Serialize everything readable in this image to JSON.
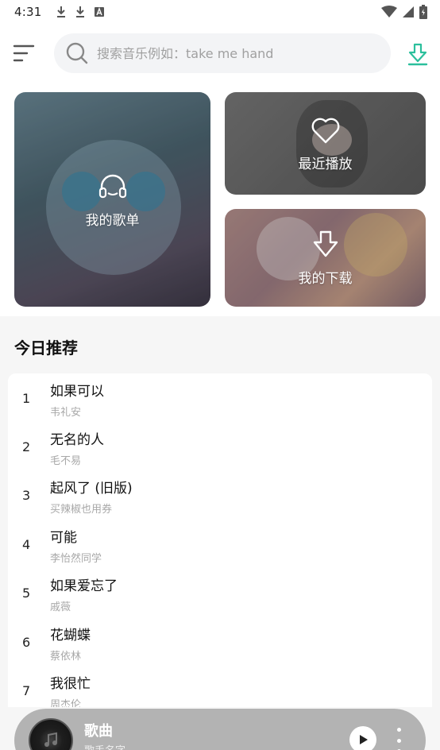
{
  "status_bar": {
    "time": "4:31"
  },
  "header": {
    "menu_icon": "menu-lines-icon",
    "search": {
      "placeholder": "搜索音乐例如：take me hand",
      "value": ""
    },
    "download_icon": "download-arrow-icon"
  },
  "cards": {
    "playlist": {
      "label": "我的歌单",
      "icon": "headphones-icon"
    },
    "recent": {
      "label": "最近播放",
      "icon": "heart-icon"
    },
    "download": {
      "label": "我的下载",
      "icon": "download-arrow-icon"
    }
  },
  "recommend": {
    "title": "今日推荐",
    "songs": [
      {
        "index": "1",
        "title": "如果可以",
        "artist": "韦礼安"
      },
      {
        "index": "2",
        "title": "无名的人",
        "artist": "毛不易"
      },
      {
        "index": "3",
        "title": "起风了 (旧版)",
        "artist": "买辣椒也用券"
      },
      {
        "index": "4",
        "title": "可能",
        "artist": "李怡然同学"
      },
      {
        "index": "5",
        "title": "如果爱忘了",
        "artist": "戚薇"
      },
      {
        "index": "6",
        "title": "花蝴蝶",
        "artist": "蔡依林"
      },
      {
        "index": "7",
        "title": "我很忙",
        "artist": "周杰伦"
      }
    ]
  },
  "player": {
    "title": "歌曲",
    "artist": "歌手名字",
    "colors": {
      "bar": "#b3b3b3",
      "accent": "#2bbf9c"
    }
  }
}
